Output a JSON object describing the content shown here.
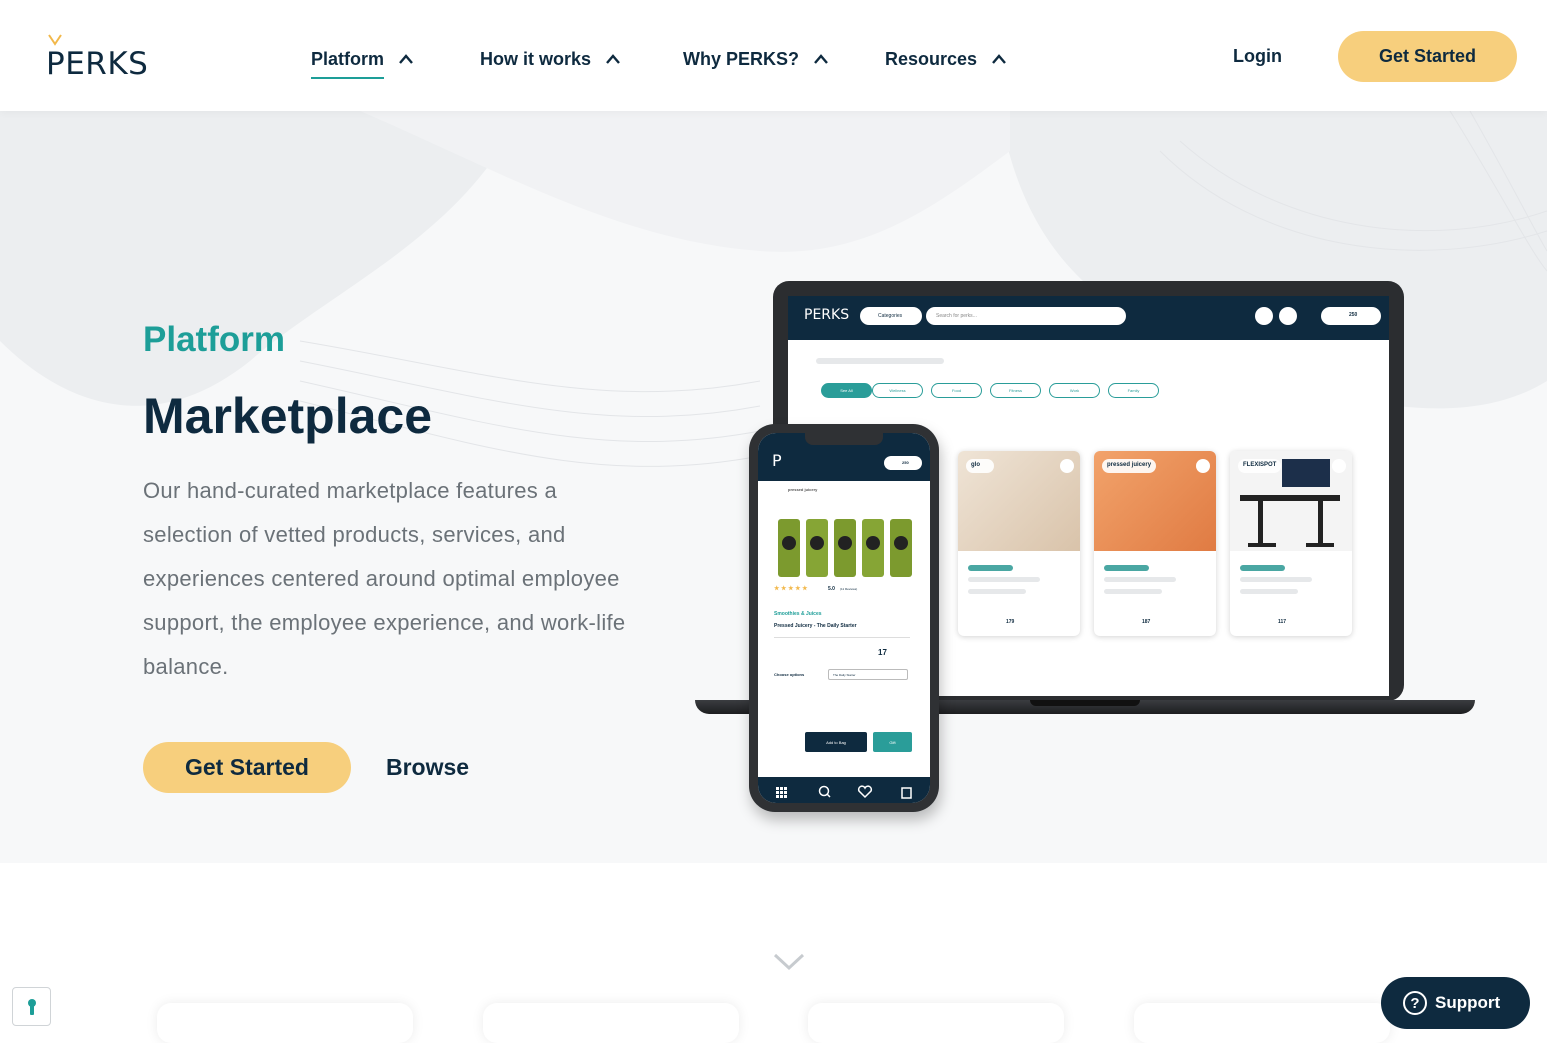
{
  "header": {
    "logo_text": "PERKS",
    "nav": [
      {
        "label": "Platform"
      },
      {
        "label": "How it works"
      },
      {
        "label": "Why PERKS?"
      },
      {
        "label": "Resources"
      }
    ],
    "login_label": "Login",
    "cta_label": "Get Started"
  },
  "hero": {
    "eyebrow": "Platform",
    "title": "Marketplace",
    "description": "Our hand-curated marketplace features a selection of vetted products, services, and experiences centered around optimal employee support, the employee experience, and work-life balance.",
    "cta_label": "Get Started",
    "browse_label": "Browse"
  },
  "laptop_screen": {
    "logo": "PERKS",
    "categories": "Categories",
    "search_placeholder": "Search for perks...",
    "locale": "US",
    "points": "250",
    "filters": [
      "See All",
      "Wellness",
      "Food",
      "Fitness",
      "Work",
      "Family"
    ],
    "cards": [
      {
        "brand": "glo",
        "price": "179"
      },
      {
        "brand": "pressed juicery",
        "price": "187"
      },
      {
        "brand": "FLEXISPOT",
        "price": "117"
      }
    ]
  },
  "phone_screen": {
    "logo": "P",
    "points": "250",
    "brand": "pressed juicery",
    "rating": "5.0",
    "reviews": "(11 Reviews)",
    "category": "Smoothies & Juices",
    "product": "Pressed Juicery - The Daily Starter",
    "price": "17",
    "choose_label": "Choose options",
    "option": "The Daily Starter",
    "add_label": "Add to Bag",
    "gift_label": "Gift"
  },
  "support_label": "Support",
  "colors": {
    "navy": "#0e2a3f",
    "teal": "#1d9e98",
    "yellow": "#f7cf7d"
  }
}
